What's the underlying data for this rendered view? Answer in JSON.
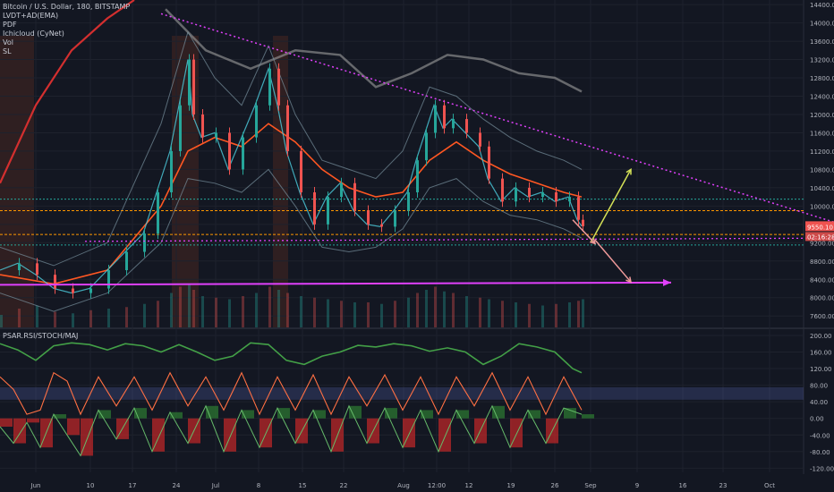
{
  "chart_data": [
    {
      "type": "candlestick",
      "title": "Bitcoin / U.S. Dollar, 180, BITSTAMP",
      "legend": [
        "LVDT+AD(EMA)",
        "PDF",
        "Ichicloud (CyNet)",
        "Vol",
        "SL"
      ],
      "yticks": [
        7600,
        8000,
        8400,
        8800,
        9200,
        9600,
        10000,
        10400,
        10800,
        11200,
        11600,
        12000,
        12400,
        12800,
        13200,
        13600,
        14000,
        14400
      ],
      "ytick_labels": [
        "7600.00",
        "8000.00",
        "8400.00",
        "8800.00",
        "9200.00",
        "9600.00",
        "10000.00",
        "10400.00",
        "10800.00",
        "11200.00",
        "11600.00",
        "12000.00",
        "12400.00",
        "12800.00",
        "13200.00",
        "13600.00",
        "14000.00",
        "14400.00"
      ],
      "ylim": [
        7350,
        14500
      ],
      "xticks": [
        "Jun",
        "10",
        "17",
        "24",
        "Jul",
        "8",
        "15",
        "22",
        "Aug",
        "12:00",
        "12",
        "19",
        "26",
        "Sep",
        "9",
        "16",
        "23",
        "Oct"
      ],
      "price": [
        [
          0,
          8600
        ],
        [
          20,
          8750
        ],
        [
          40,
          8500
        ],
        [
          60,
          8200
        ],
        [
          80,
          8100
        ],
        [
          100,
          8200
        ],
        [
          120,
          8600
        ],
        [
          140,
          9000
        ],
        [
          160,
          9400
        ],
        [
          175,
          10300
        ],
        [
          190,
          11200
        ],
        [
          200,
          12200
        ],
        [
          210,
          13200
        ],
        [
          215,
          12000
        ],
        [
          225,
          11500
        ],
        [
          240,
          11600
        ],
        [
          255,
          10800
        ],
        [
          270,
          11500
        ],
        [
          285,
          12200
        ],
        [
          300,
          13000
        ],
        [
          310,
          12200
        ],
        [
          320,
          11200
        ],
        [
          335,
          10300
        ],
        [
          350,
          9600
        ],
        [
          365,
          10200
        ],
        [
          380,
          10500
        ],
        [
          395,
          9900
        ],
        [
          410,
          9600
        ],
        [
          425,
          9550
        ],
        [
          440,
          9900
        ],
        [
          455,
          10300
        ],
        [
          465,
          11000
        ],
        [
          475,
          11600
        ],
        [
          485,
          12200
        ],
        [
          495,
          11700
        ],
        [
          505,
          11900
        ],
        [
          520,
          11600
        ],
        [
          535,
          11300
        ],
        [
          545,
          10600
        ],
        [
          560,
          10100
        ],
        [
          575,
          10400
        ],
        [
          590,
          10200
        ],
        [
          605,
          10300
        ],
        [
          620,
          10100
        ],
        [
          635,
          10200
        ],
        [
          645,
          9700
        ],
        [
          650,
          9560
        ]
      ],
      "volume": [
        [
          0,
          40
        ],
        [
          20,
          60
        ],
        [
          40,
          70
        ],
        [
          60,
          50
        ],
        [
          80,
          45
        ],
        [
          100,
          55
        ],
        [
          120,
          60
        ],
        [
          140,
          65
        ],
        [
          160,
          75
        ],
        [
          175,
          85
        ],
        [
          190,
          110
        ],
        [
          200,
          130
        ],
        [
          210,
          140
        ],
        [
          215,
          120
        ],
        [
          225,
          100
        ],
        [
          240,
          95
        ],
        [
          255,
          90
        ],
        [
          270,
          100
        ],
        [
          285,
          110
        ],
        [
          300,
          130
        ],
        [
          310,
          120
        ],
        [
          320,
          110
        ],
        [
          335,
          100
        ],
        [
          350,
          95
        ],
        [
          365,
          90
        ],
        [
          380,
          85
        ],
        [
          395,
          80
        ],
        [
          410,
          80
        ],
        [
          425,
          75
        ],
        [
          440,
          85
        ],
        [
          455,
          95
        ],
        [
          465,
          110
        ],
        [
          475,
          120
        ],
        [
          485,
          130
        ],
        [
          495,
          115
        ],
        [
          505,
          110
        ],
        [
          520,
          100
        ],
        [
          535,
          95
        ],
        [
          545,
          90
        ],
        [
          560,
          85
        ],
        [
          575,
          80
        ],
        [
          590,
          75
        ],
        [
          605,
          70
        ],
        [
          620,
          75
        ],
        [
          635,
          80
        ],
        [
          645,
          85
        ],
        [
          650,
          90
        ]
      ],
      "upper_band": [
        [
          0,
          9100
        ],
        [
          60,
          8700
        ],
        [
          120,
          9200
        ],
        [
          180,
          11800
        ],
        [
          210,
          13800
        ],
        [
          240,
          12800
        ],
        [
          270,
          12200
        ],
        [
          300,
          13500
        ],
        [
          330,
          12000
        ],
        [
          360,
          11000
        ],
        [
          390,
          10800
        ],
        [
          420,
          10600
        ],
        [
          450,
          11200
        ],
        [
          480,
          12600
        ],
        [
          510,
          12400
        ],
        [
          540,
          11900
        ],
        [
          570,
          11500
        ],
        [
          600,
          11200
        ],
        [
          630,
          11000
        ],
        [
          650,
          10800
        ]
      ],
      "lower_band": [
        [
          0,
          8100
        ],
        [
          60,
          7700
        ],
        [
          120,
          8100
        ],
        [
          180,
          9200
        ],
        [
          210,
          10600
        ],
        [
          240,
          10500
        ],
        [
          270,
          10300
        ],
        [
          300,
          10800
        ],
        [
          330,
          10000
        ],
        [
          360,
          9100
        ],
        [
          390,
          9000
        ],
        [
          420,
          9100
        ],
        [
          450,
          9500
        ],
        [
          480,
          10400
        ],
        [
          510,
          10600
        ],
        [
          540,
          10100
        ],
        [
          570,
          9800
        ],
        [
          600,
          9700
        ],
        [
          630,
          9500
        ],
        [
          650,
          9300
        ]
      ],
      "moving_average": [
        [
          0,
          8500
        ],
        [
          60,
          8300
        ],
        [
          120,
          8600
        ],
        [
          180,
          10000
        ],
        [
          210,
          11200
        ],
        [
          240,
          11500
        ],
        [
          270,
          11300
        ],
        [
          300,
          11800
        ],
        [
          330,
          11400
        ],
        [
          360,
          10800
        ],
        [
          390,
          10400
        ],
        [
          420,
          10200
        ],
        [
          450,
          10300
        ],
        [
          480,
          11000
        ],
        [
          510,
          11400
        ],
        [
          540,
          11000
        ],
        [
          570,
          10700
        ],
        [
          600,
          10500
        ],
        [
          630,
          10300
        ],
        [
          650,
          10200
        ]
      ],
      "red_ma": [
        [
          0,
          10500
        ],
        [
          40,
          12200
        ],
        [
          80,
          13400
        ],
        [
          120,
          14100
        ],
        [
          150,
          14500
        ]
      ],
      "grey_wave": [
        [
          185,
          14300
        ],
        [
          230,
          13400
        ],
        [
          280,
          13000
        ],
        [
          330,
          13400
        ],
        [
          380,
          13300
        ],
        [
          420,
          12600
        ],
        [
          460,
          12900
        ],
        [
          500,
          13300
        ],
        [
          540,
          13200
        ],
        [
          580,
          12900
        ],
        [
          620,
          12800
        ],
        [
          650,
          12500
        ]
      ],
      "support_lines": [
        {
          "price": 10150,
          "color": "#26a69a",
          "dash": "2,2"
        },
        {
          "price": 9900,
          "color": "#ff9800",
          "dash": "3,2"
        },
        {
          "price": 9380,
          "color": "#ff9800",
          "dash": "3,2"
        },
        {
          "price": 9150,
          "color": "#26a69a",
          "dash": "2,2"
        }
      ],
      "resistance_trend": [
        [
          180,
          14200
        ],
        [
          932,
          9650
        ]
      ],
      "magenta_dotted": [
        [
          95,
          9230
        ],
        [
          932,
          9300
        ]
      ],
      "magenta_solid": [
        [
          0,
          8280
        ],
        [
          750,
          8330
        ]
      ],
      "projection_up": [
        [
          660,
          9200
        ],
        [
          705,
          10800
        ]
      ],
      "projection_mid": [
        [
          640,
          9700
        ],
        [
          665,
          9180
        ]
      ],
      "projection_down": [
        [
          665,
          9260
        ],
        [
          705,
          8340
        ]
      ],
      "current_price": "9550.10",
      "countdown": "02:16:28",
      "colors": {
        "up": "#26a69a",
        "down": "#ef5350",
        "magenta": "#e040fb",
        "orange": "#ff9800",
        "teal": "#00bfa5"
      }
    },
    {
      "type": "line",
      "title": "PSAR.RSI/STOCH/MAJ",
      "yticks": [
        -120,
        -80,
        -40,
        0,
        40,
        80,
        120,
        160,
        200
      ],
      "ytick_labels": [
        "-120.00",
        "-80.00",
        "-40.00",
        "0.00",
        "40.00",
        "80.00",
        "120.00",
        "160.00",
        "200.00"
      ],
      "ylim": [
        -130,
        215
      ],
      "band": [
        45,
        75
      ],
      "rsi_line": [
        [
          0,
          180
        ],
        [
          20,
          165
        ],
        [
          40,
          140
        ],
        [
          60,
          175
        ],
        [
          80,
          182
        ],
        [
          100,
          178
        ],
        [
          120,
          165
        ],
        [
          140,
          180
        ],
        [
          160,
          175
        ],
        [
          180,
          160
        ],
        [
          200,
          178
        ],
        [
          220,
          160
        ],
        [
          240,
          140
        ],
        [
          260,
          150
        ],
        [
          280,
          182
        ],
        [
          300,
          178
        ],
        [
          320,
          140
        ],
        [
          340,
          130
        ],
        [
          360,
          150
        ],
        [
          380,
          160
        ],
        [
          400,
          176
        ],
        [
          420,
          172
        ],
        [
          440,
          180
        ],
        [
          460,
          175
        ],
        [
          480,
          162
        ],
        [
          500,
          170
        ],
        [
          520,
          160
        ],
        [
          540,
          130
        ],
        [
          560,
          150
        ],
        [
          580,
          180
        ],
        [
          600,
          172
        ],
        [
          620,
          160
        ],
        [
          640,
          120
        ],
        [
          650,
          110
        ]
      ],
      "stoch_line": [
        [
          0,
          100
        ],
        [
          15,
          70
        ],
        [
          30,
          10
        ],
        [
          45,
          20
        ],
        [
          60,
          110
        ],
        [
          75,
          90
        ],
        [
          90,
          10
        ],
        [
          110,
          100
        ],
        [
          130,
          30
        ],
        [
          150,
          100
        ],
        [
          170,
          20
        ],
        [
          190,
          110
        ],
        [
          210,
          30
        ],
        [
          230,
          100
        ],
        [
          250,
          20
        ],
        [
          270,
          110
        ],
        [
          290,
          10
        ],
        [
          310,
          100
        ],
        [
          330,
          20
        ],
        [
          350,
          105
        ],
        [
          370,
          10
        ],
        [
          390,
          100
        ],
        [
          410,
          30
        ],
        [
          430,
          105
        ],
        [
          450,
          20
        ],
        [
          470,
          100
        ],
        [
          490,
          10
        ],
        [
          510,
          100
        ],
        [
          530,
          30
        ],
        [
          550,
          110
        ],
        [
          570,
          20
        ],
        [
          590,
          100
        ],
        [
          610,
          10
        ],
        [
          630,
          100
        ],
        [
          650,
          20
        ]
      ],
      "maj_osc": [
        [
          0,
          -20
        ],
        [
          15,
          -60
        ],
        [
          30,
          -10
        ],
        [
          45,
          -70
        ],
        [
          60,
          10
        ],
        [
          75,
          -40
        ],
        [
          90,
          -90
        ],
        [
          110,
          20
        ],
        [
          130,
          -50
        ],
        [
          150,
          25
        ],
        [
          170,
          -80
        ],
        [
          190,
          15
        ],
        [
          210,
          -60
        ],
        [
          230,
          30
        ],
        [
          250,
          -80
        ],
        [
          270,
          20
        ],
        [
          290,
          -70
        ],
        [
          310,
          25
        ],
        [
          330,
          -60
        ],
        [
          350,
          20
        ],
        [
          370,
          -80
        ],
        [
          390,
          30
        ],
        [
          410,
          -60
        ],
        [
          430,
          25
        ],
        [
          450,
          -70
        ],
        [
          470,
          20
        ],
        [
          490,
          -80
        ],
        [
          510,
          20
        ],
        [
          530,
          -60
        ],
        [
          550,
          30
        ],
        [
          570,
          -70
        ],
        [
          590,
          20
        ],
        [
          610,
          -60
        ],
        [
          630,
          25
        ],
        [
          650,
          10
        ]
      ]
    }
  ]
}
